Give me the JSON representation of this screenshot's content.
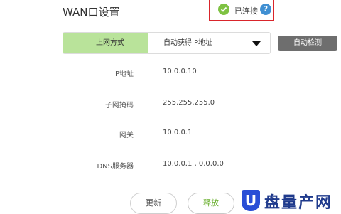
{
  "header": {
    "title": "WAN口设置",
    "status_text": "已连接",
    "help_symbol": "?"
  },
  "wan": {
    "mode_label": "上网方式",
    "mode_value": "自动获得IP地址",
    "auto_detect_label": "自动检测"
  },
  "rows": [
    {
      "label": "IP地址",
      "value": "10.0.0.10"
    },
    {
      "label": "子网掩码",
      "value": "255.255.255.0"
    },
    {
      "label": "网关",
      "value": "10.0.0.1"
    },
    {
      "label": "DNS服务器",
      "value": "10.0.0.1 , 0.0.0.0"
    }
  ],
  "actions": {
    "renew_label": "更新",
    "release_label": "释放"
  },
  "watermark": {
    "mark": "U",
    "text": "盘量产网"
  },
  "colors": {
    "status_ok": "#7ec242",
    "highlight_border": "#d9252b",
    "help": "#3f8fd2",
    "mode_label_bg": "#b9e39a",
    "release_text": "#6aaf2e"
  },
  "icons": {
    "status": "check-circle-icon",
    "help": "question-icon",
    "dropdown": "caret-down-icon"
  }
}
